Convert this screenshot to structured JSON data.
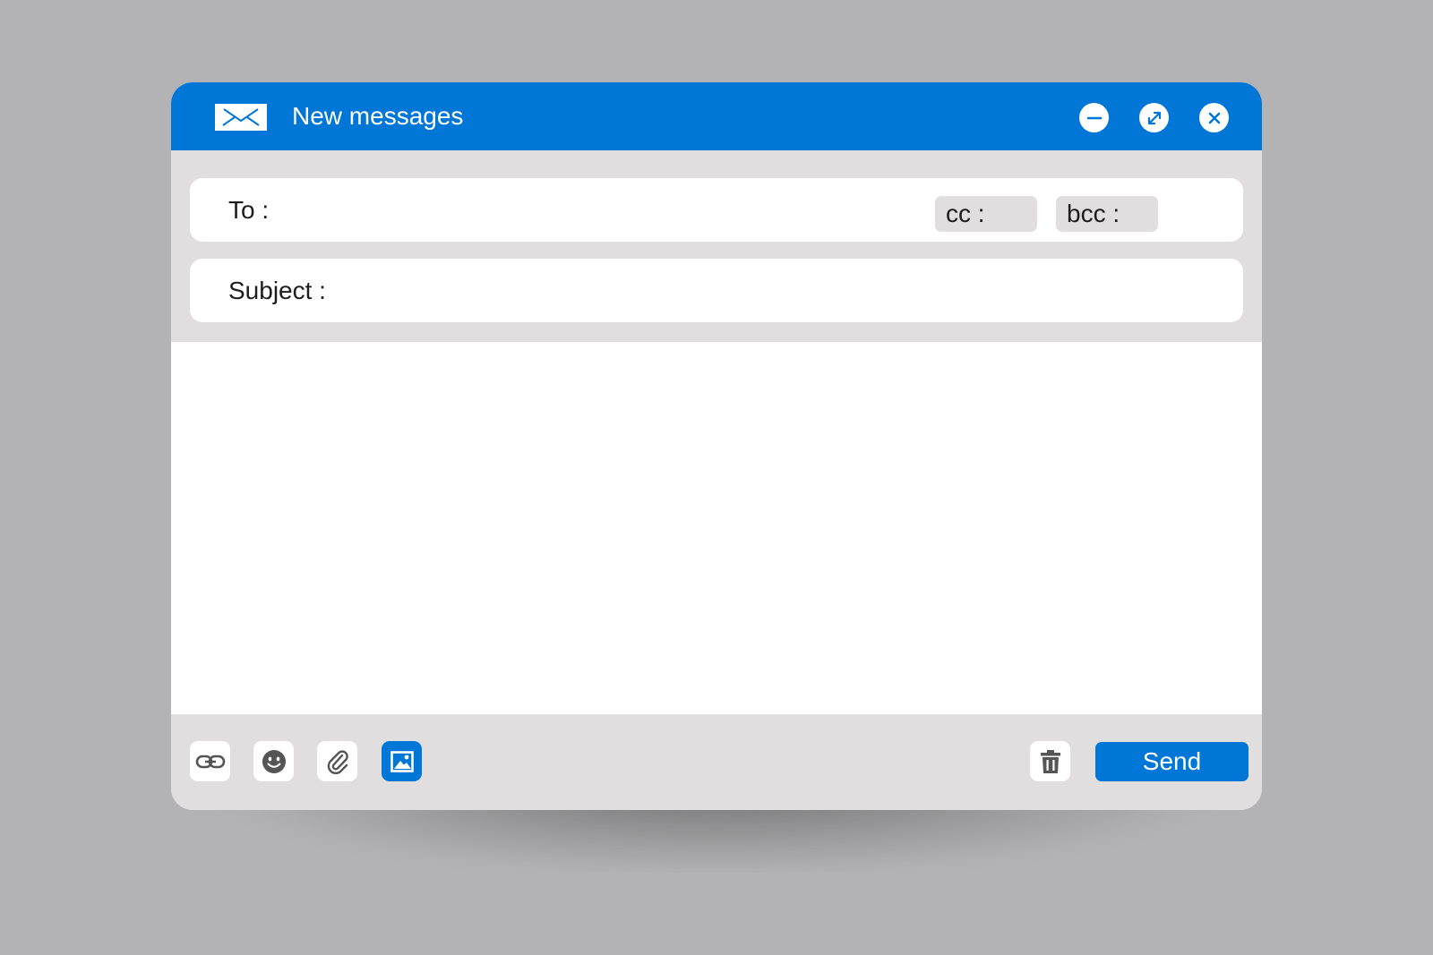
{
  "window": {
    "title": "New messages",
    "controls": {
      "minimize_icon": "minus-circle-icon",
      "maximize_icon": "expand-arrows-icon",
      "close_icon": "x-icon"
    }
  },
  "compose": {
    "to": {
      "label": "To :",
      "value": ""
    },
    "cc": {
      "label": "cc :"
    },
    "bcc": {
      "label": "bcc :"
    },
    "subject": {
      "label": "Subject :",
      "value": ""
    },
    "body": {
      "value": ""
    }
  },
  "toolbar": {
    "tools": [
      {
        "icon": "link-icon",
        "active": false
      },
      {
        "icon": "emoji-icon",
        "active": false
      },
      {
        "icon": "paperclip-icon",
        "active": false
      },
      {
        "icon": "image-icon",
        "active": true
      }
    ],
    "delete_icon": "trash-icon",
    "send_label": "Send"
  },
  "colors": {
    "accent": "#0076d7",
    "panel": "#e1dedf",
    "backdrop": "#b3b3b5",
    "text": "#1d1d1d",
    "icon_gray": "#555555"
  }
}
